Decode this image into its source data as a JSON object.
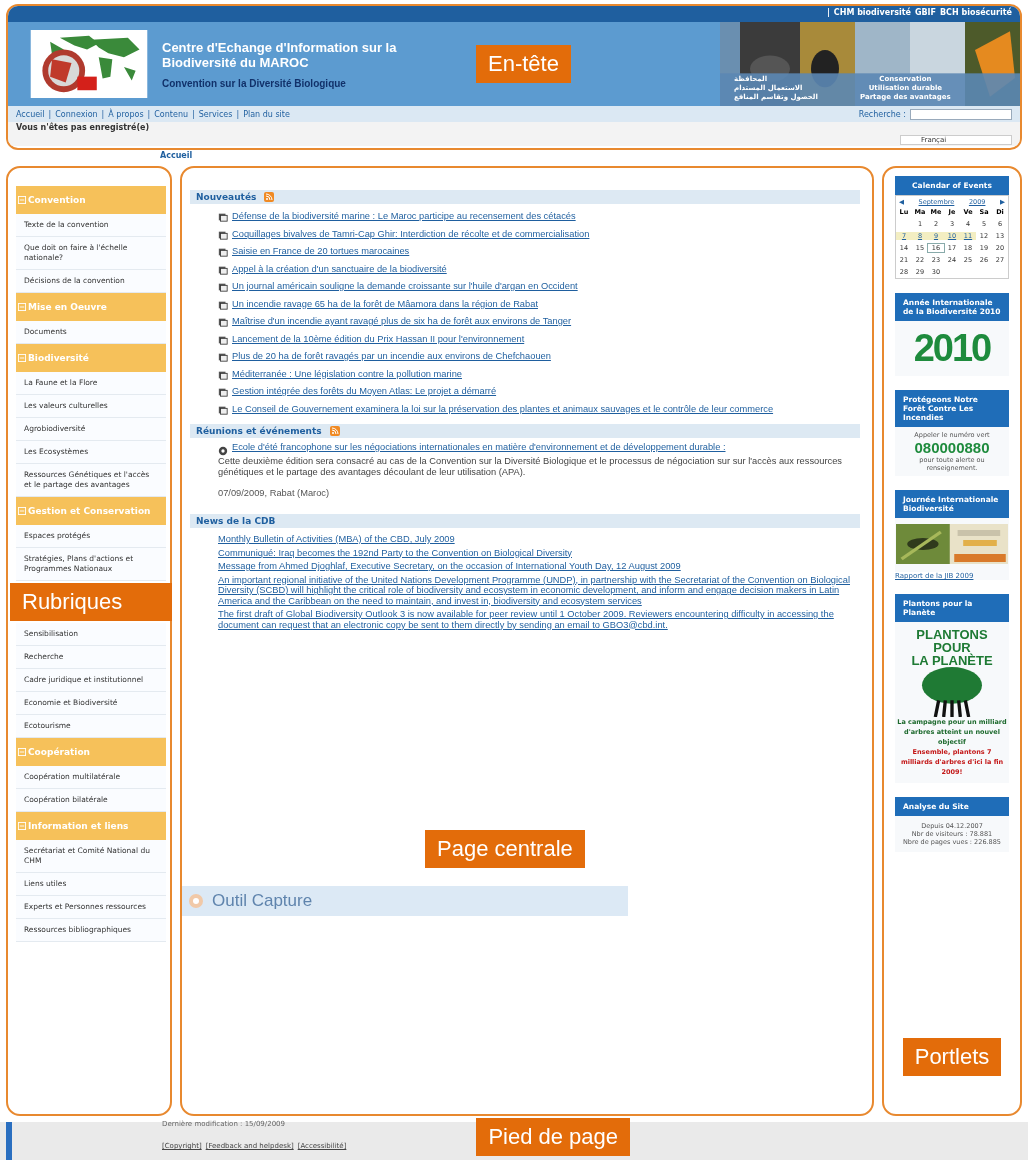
{
  "top_bar": {
    "separator": "|",
    "links": [
      "CHM biodiversité",
      "GBIF",
      "BCH biosécurité"
    ]
  },
  "header": {
    "annotation": "En-tête",
    "title": "Centre d'Echange d'Information sur la Biodiversité du MAROC",
    "subtitle": "Convention sur la Diversité Biologique",
    "arabic_slogan": [
      "المحافظة",
      "الاستعمال المستدام",
      "الحصول وتقاسم المنافع"
    ],
    "french_slogan": [
      "Conservation",
      "Utilisation durable",
      "Partage des avantages"
    ]
  },
  "nav": {
    "separator": "|",
    "items": [
      "Accueil",
      "Connexion",
      "À propos",
      "Contenu",
      "Services",
      "Plan du site"
    ],
    "search_label": "Recherche :"
  },
  "login_status": "Vous n'êtes pas enregistré(e)",
  "language": "Françai",
  "breadcrumb": "Accueil",
  "sidebar": {
    "sections": [
      {
        "title": "Convention",
        "expanded": true,
        "items": [
          {
            "kind": "link",
            "label": "Texte de la convention"
          },
          {
            "kind": "link",
            "label": "Que doit on faire à l'échelle nationale?"
          },
          {
            "kind": "link",
            "label": "Décisions de la convention"
          }
        ]
      },
      {
        "title": "Mise en Oeuvre",
        "expanded": true,
        "items": [
          {
            "kind": "link",
            "label": "Documents"
          }
        ]
      },
      {
        "title": "Biodiversité",
        "expanded": true,
        "items": [
          {
            "kind": "link",
            "label": "La Faune et la Flore"
          },
          {
            "kind": "link",
            "label": "Les valeurs culturelles"
          },
          {
            "kind": "link",
            "label": "Agrobiodiversité"
          },
          {
            "kind": "link",
            "label": "Les Ecosystèmes"
          },
          {
            "kind": "link",
            "label": "Ressources Génétiques et l'accès et le partage des avantages"
          }
        ]
      },
      {
        "title": "Gestion et Conservation",
        "expanded": true,
        "items": [
          {
            "kind": "link",
            "label": "Espaces protégés"
          },
          {
            "kind": "link",
            "label": "Stratégies, Plans d'actions et Programmes Nationaux"
          },
          {
            "kind": "annotation",
            "label": "Rubriques"
          },
          {
            "kind": "link",
            "label": "Sensibilisation"
          },
          {
            "kind": "link",
            "label": "Recherche"
          },
          {
            "kind": "link",
            "label": "Cadre juridique et institutionnel"
          },
          {
            "kind": "link",
            "label": "Economie et Biodiversité"
          },
          {
            "kind": "link",
            "label": "Ecotourisme"
          }
        ]
      },
      {
        "title": "Coopération",
        "expanded": true,
        "items": [
          {
            "kind": "link",
            "label": "Coopération multilatérale"
          },
          {
            "kind": "link",
            "label": "Coopération bilatérale"
          }
        ]
      },
      {
        "title": "Information et liens",
        "expanded": true,
        "items": [
          {
            "kind": "link",
            "label": "Secrétariat et Comité National du CHM"
          },
          {
            "kind": "link",
            "label": "Liens utiles"
          },
          {
            "kind": "link",
            "label": "Experts et Personnes ressources"
          },
          {
            "kind": "link",
            "label": "Ressources bibliographiques"
          }
        ]
      }
    ]
  },
  "center": {
    "annotation": "Page centrale",
    "capture_bar": "Outil Capture",
    "news": {
      "title": "Nouveautés",
      "rss": true,
      "items": [
        "Défense de la biodiversité marine : Le Maroc participe au recensement des cétacés",
        "Coquillages bivalves de Tamri-Cap Ghir: Interdiction de récolte et de commercialisation",
        "Saisie en France de 20 tortues marocaines",
        "Appel à la création d'un sanctuaire de la biodiversité",
        "Un journal américain souligne la demande croissante sur l'huile d'argan en Occident",
        "Un incendie ravage 65 ha de la forêt de Mâamora dans la région de Rabat",
        "Maîtrise d'un incendie ayant ravagé plus de six ha de forêt aux environs de Tanger",
        "Lancement de la 10ème édition du Prix Hassan II pour l'environnement",
        "Plus de 20 ha de forêt ravagés par un incendie aux environs de Chefchaouen",
        "Méditerranée : Une législation contre la pollution marine",
        "Gestion intégrée des forêts du Moyen Atlas: Le projet a démarré",
        "Le Conseil de Gouvernement examinera la loi sur la préservation des plantes et animaux sauvages et le contrôle de leur commerce"
      ]
    },
    "events": {
      "title": "Réunions et événements",
      "rss": true,
      "items": [
        {
          "link": "Ecole d'été francophone sur les négociations internationales en matière d'environnement et de développement durable :",
          "description": "Cette deuxième édition sera consacré au cas de la Convention sur la Diversité Biologique et le processus de négociation sur sur l'accès aux ressources génétiques et le partage des avantages découlant de leur utilisation (APA).",
          "date": "07/09/2009, Rabat (Maroc)"
        }
      ]
    },
    "cbd": {
      "title": "News de la CDB",
      "rss": false,
      "items": [
        "Monthly Bulletin of Activities (MBA) of the CBD, July 2009",
        "Communiqué: Iraq becomes the 192nd Party to the Convention on Biological Diversity",
        "Message from Ahmed Djoghlaf, Executive Secretary, on the occasion of International Youth Day, 12 August 2009",
        "An important regional initiative of the United Nations Development Programme (UNDP), in partnership with the Secretariat of the Convention on Biological Diversity (SCBD) will highlight the critical role of biodiversity and ecosystem in economic development, and inform and engage decision makers in Latin America and the Caribbean on the need to maintain, and invest in, biodiversity and ecosystem services",
        "The first draft of Global Biodiversity Outlook 3 is now available for peer review until 1 October 2009. Reviewers encountering difficulty in accessing the document can request that an electronic copy be sent to them directly by sending an email to GBO3@cbd.int."
      ]
    }
  },
  "portlets": {
    "annotation": "Portlets",
    "items": [
      {
        "kind": "calendar",
        "title": "Calendar of Events",
        "month": "Septembre",
        "year": "2009",
        "prev": "◀",
        "next": "▶",
        "weekdays": [
          "Lu",
          "Ma",
          "Me",
          "Je",
          "Ve",
          "Sa",
          "Di"
        ],
        "weeks": [
          [
            {
              "day": "1",
              "event": false,
              "today": false
            },
            {
              "day": "2",
              "event": false,
              "today": false
            },
            {
              "day": "3",
              "event": false,
              "today": false
            },
            {
              "day": "4",
              "event": false,
              "today": false
            },
            {
              "day": "5",
              "event": false,
              "today": false
            },
            {
              "day": "6",
              "event": false,
              "today": false
            }
          ],
          [
            {
              "day": "7",
              "event": true,
              "today": false
            },
            {
              "day": "8",
              "event": true,
              "today": false
            },
            {
              "day": "9",
              "event": true,
              "today": false
            },
            {
              "day": "10",
              "event": true,
              "today": false
            },
            {
              "day": "11",
              "event": true,
              "today": false
            },
            {
              "day": "12",
              "event": false,
              "today": false
            },
            {
              "day": "13",
              "event": false,
              "today": false
            }
          ],
          [
            {
              "day": "14",
              "event": false,
              "today": false
            },
            {
              "day": "15",
              "event": false,
              "today": false
            },
            {
              "day": "16",
              "event": false,
              "today": true
            },
            {
              "day": "17",
              "event": false,
              "today": false
            },
            {
              "day": "18",
              "event": false,
              "today": false
            },
            {
              "day": "19",
              "event": false,
              "today": false
            },
            {
              "day": "20",
              "event": false,
              "today": false
            }
          ],
          [
            {
              "day": "21",
              "event": false,
              "today": false
            },
            {
              "day": "22",
              "event": false,
              "today": false
            },
            {
              "day": "23",
              "event": false,
              "today": false
            },
            {
              "day": "24",
              "event": false,
              "today": false
            },
            {
              "day": "25",
              "event": false,
              "today": false
            },
            {
              "day": "26",
              "event": false,
              "today": false
            },
            {
              "day": "27",
              "event": false,
              "today": false
            }
          ],
          [
            {
              "day": "28",
              "event": false,
              "today": false
            },
            {
              "day": "29",
              "event": false,
              "today": false
            },
            {
              "day": "30",
              "event": false,
              "today": false
            }
          ]
        ]
      },
      {
        "kind": "year_logo",
        "title": "Année Internationale de la Biodiversité 2010",
        "logo_text": "2010"
      },
      {
        "kind": "hotline",
        "title": "Protégeons Notre Forêt Contre Les Incendies",
        "intro": "Appeler le numéro vert",
        "number": "080000880",
        "outro": "pour toute alerte ou renseignement."
      },
      {
        "kind": "photo_link",
        "title": "Journée Internationale Biodiversité",
        "link": "Rapport de la JIB 2009"
      },
      {
        "kind": "campaign",
        "title": "Plantons pour la Planète",
        "logo_lines": [
          "PLANTONS",
          "POUR",
          "LA PLANÈTE"
        ],
        "caption": "La campagne pour un milliard d'arbres atteint un nouvel objectif",
        "call": "Ensemble, plantons 7 milliards d'arbres d'ici la fin 2009!"
      },
      {
        "kind": "stats",
        "title": "Analyse du Site",
        "lines": [
          "Depuis 04.12.2007",
          "Nbr de visiteurs : 78.881",
          "Nbre de pages vues : 226.885"
        ]
      }
    ]
  },
  "footer": {
    "annotation": "Pied de page",
    "last_modified": "Dernière modification : 15/09/2009",
    "links": [
      "[Copyright]",
      "[Feedback and helpdesk]",
      "[Accessibilité]"
    ]
  }
}
